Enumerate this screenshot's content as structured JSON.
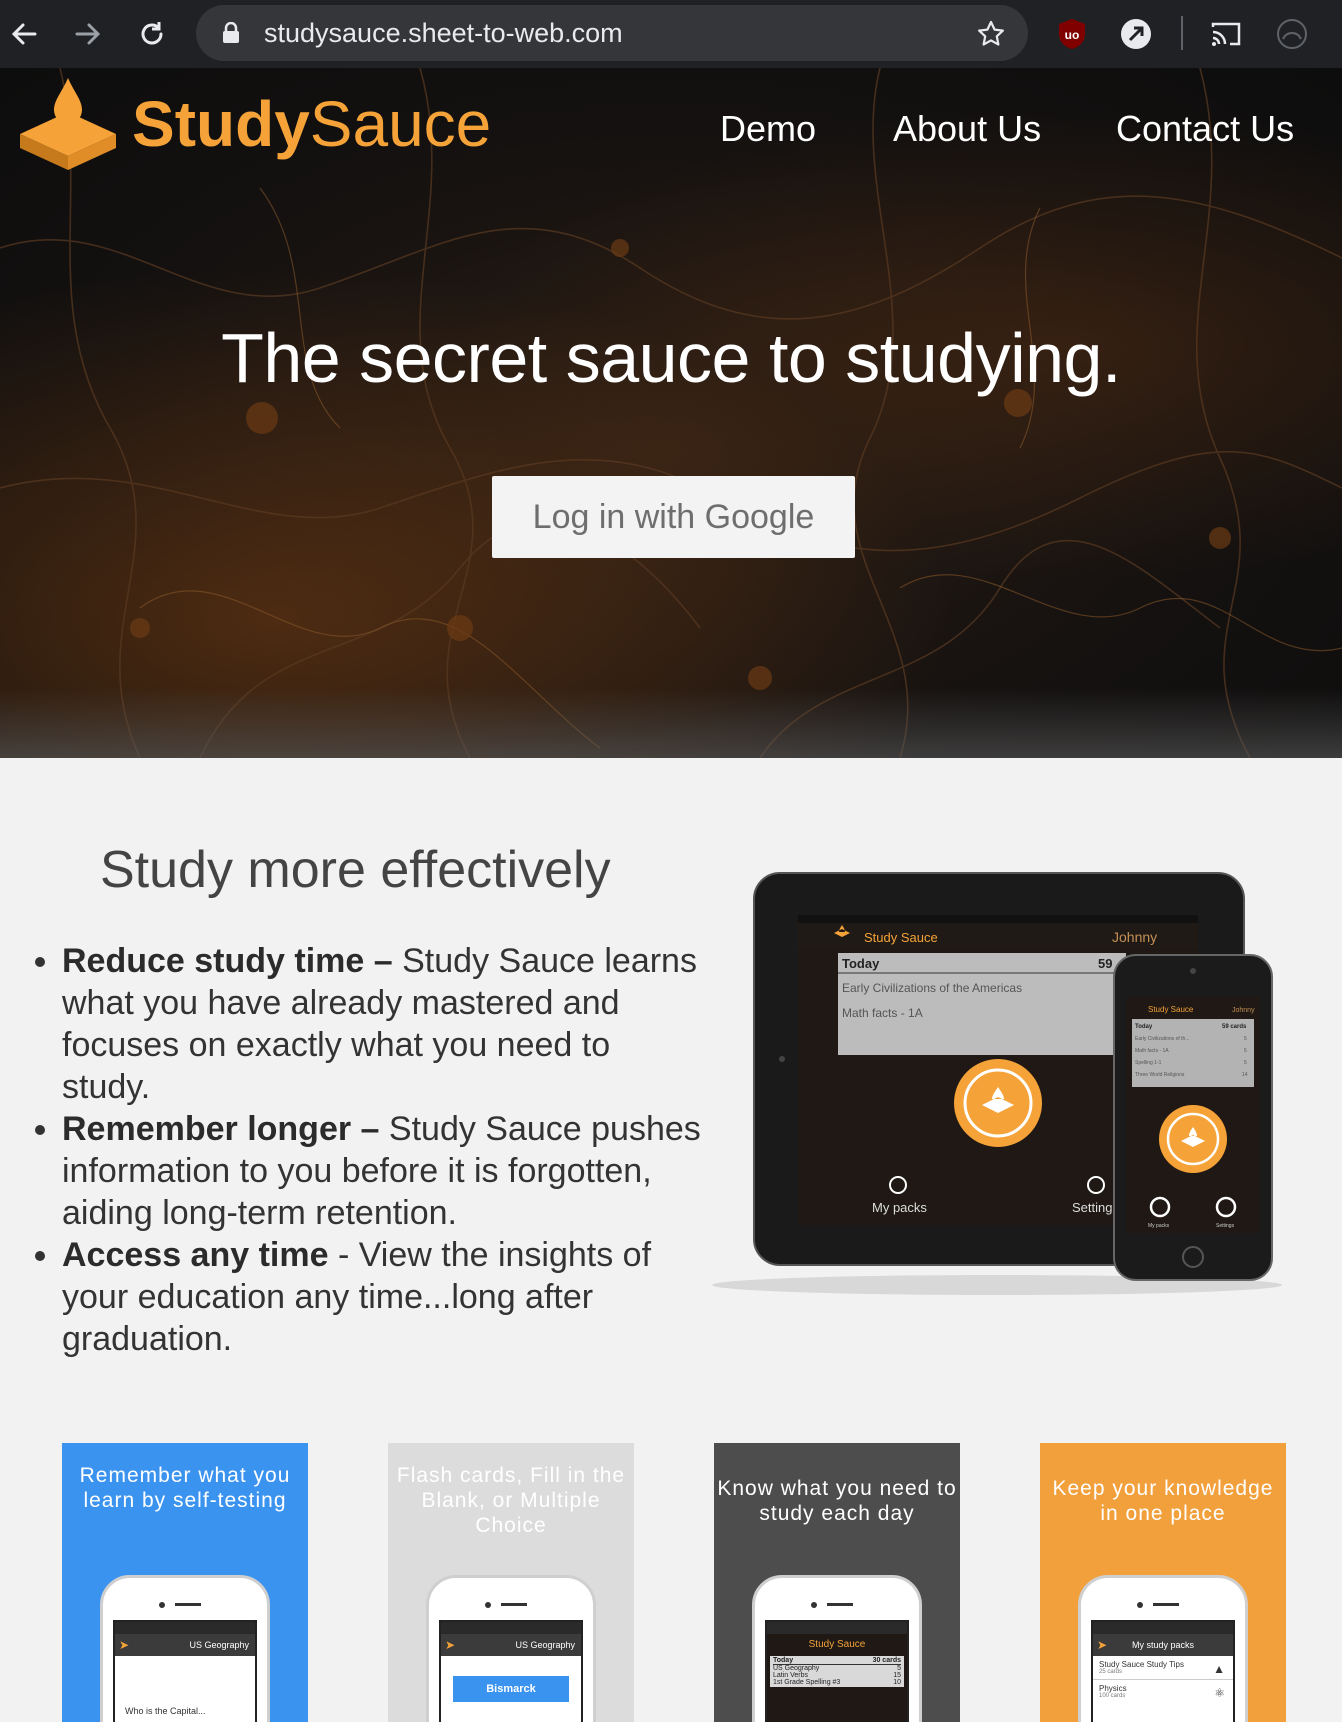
{
  "browser": {
    "url": "studysauce.sheet-to-web.com"
  },
  "site": {
    "logo_bold": "Study",
    "logo_light": "Sauce",
    "nav": [
      "Demo",
      "About Us",
      "Contact Us"
    ]
  },
  "hero": {
    "headline": "The secret sauce to studying.",
    "login_label": "Log in with Google"
  },
  "features": {
    "title": "Study more effectively",
    "items": [
      {
        "bold": "Reduce study time",
        "dash": " – ",
        "text": "Study Sauce learns what you have already mastered and focuses on exactly what you need to study."
      },
      {
        "bold": "Remember longer",
        "dash": " – ",
        "text": "Study Sauce pushes information to you before it is forgotten, aiding long-term retention."
      },
      {
        "bold": "Access any time",
        "dash": " - ",
        "text": "View the insights of your education any time...long after graduation."
      }
    ]
  },
  "device_mockup": {
    "brand": "Study Sauce",
    "user": "Johnny",
    "today": "Today",
    "count": "59",
    "rows": [
      "Early Civilizations of the Americas",
      "Math facts - 1A"
    ],
    "my_packs": "My packs",
    "settings": "Setting",
    "phone_brand": "Study Sauce",
    "phone_user": "Johnny",
    "phone_today": "Today",
    "phone_count": "59 cards",
    "phone_rows": [
      "Early Civilizations of th...",
      "Math facts - 1A",
      "Spelling 1-1",
      "Three World Religions"
    ],
    "phone_counts": [
      "5",
      "5",
      "5",
      "14"
    ],
    "phone_my_packs": "My packs",
    "phone_settings": "Settings"
  },
  "cards": [
    {
      "title": "Remember what you learn by self-testing",
      "bg": "#3b93f0",
      "fg": "#ffffff",
      "screen_title": "US Geography",
      "screen_text": "Who is the Capital..."
    },
    {
      "title": "Flash cards, Fill in the Blank, or Multiple Choice",
      "bg": "#dcdcdc",
      "fg": "#ffffff",
      "screen_title": "US Geography",
      "screen_button": "Bismarck"
    },
    {
      "title": "Know what you need to study each day",
      "bg": "#4d4d4d",
      "fg": "#ffffff",
      "screen_brand": "Study Sauce",
      "screen_today": "Today",
      "screen_count": "30 cards",
      "screen_rows": [
        "US Geography",
        "Latin Verbs",
        "1st Grade Spelling #3"
      ],
      "screen_counts": [
        "5",
        "15",
        "10"
      ]
    },
    {
      "title": "Keep your knowledge in one place",
      "bg": "#f2a03b",
      "fg": "#ffffff",
      "screen_title": "My study packs",
      "screen_rows": [
        "Study Sauce Study Tips",
        "Physics"
      ],
      "screen_subs": [
        "25 cards",
        "100 cards"
      ]
    }
  ],
  "colors": {
    "brand_orange": "#f5a338",
    "chrome_bg": "#202124",
    "page_bg": "#f2f2f2"
  }
}
